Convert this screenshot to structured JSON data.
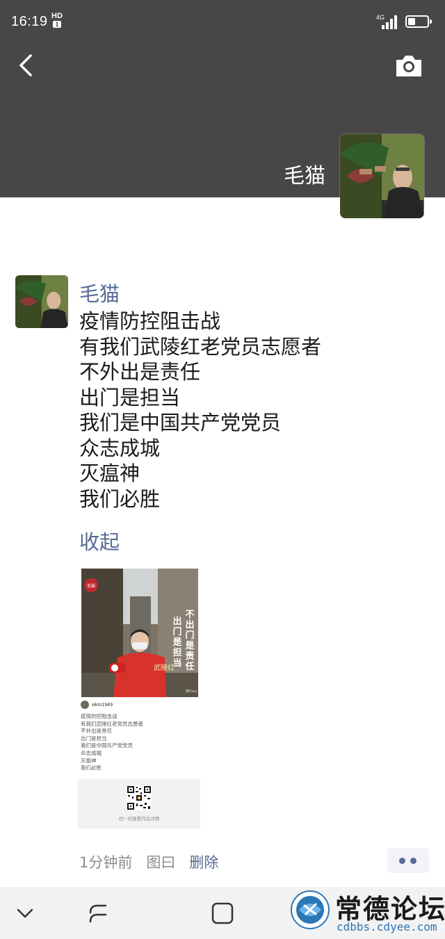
{
  "status_bar": {
    "time": "16:19",
    "hd_label": "HD",
    "hd_sub": "1",
    "network": "4G",
    "signal_icon": "signal-bars-icon",
    "battery_icon": "battery-icon",
    "battery_level": 0.4
  },
  "header": {
    "back_icon": "chevron-left-icon",
    "camera_icon": "camera-icon",
    "profile_name": "毛猫"
  },
  "post": {
    "author": "毛猫",
    "lines": [
      "疫情防控阻击战",
      "有我们武陵红老党员志愿者",
      "不外出是责任",
      "出门是担当",
      "我们是中国共产党党员",
      "众志成城",
      "灭瘟神",
      "我们必胜"
    ],
    "collapse_label": "收起",
    "card": {
      "poster_badge": "毛猫",
      "poster_calligraphy_col1": "不出门是责任",
      "poster_calligraphy_col2": "出门是担当",
      "poster_vest_text": "武陵红",
      "poster_watermark": "微Face",
      "username": "wkm1949",
      "text_lines": [
        "疫情防控阻击战",
        "有我们武陵红老党员志愿者",
        "不外出是责任",
        "出门是担当",
        "我们是中国共产党党员",
        "众志成城",
        "灭瘟神",
        "我们必胜"
      ],
      "qr_caption": "扫一扫查看作品详情"
    },
    "meta": {
      "time": "1分钟前",
      "source": "图曰",
      "delete_label": "删除"
    },
    "more_icon": "more-dots-icon"
  },
  "nav_bar": {
    "hide_icon": "chevron-down-icon",
    "back_icon": "nav-back-icon",
    "home_icon": "nav-home-icon"
  },
  "watermark": {
    "title": "常德论坛",
    "url": "cdbbs.cdyee.com"
  },
  "colors": {
    "link": "#576b95",
    "cover_bg": "#474747",
    "nav_bg": "#f2f2f2"
  }
}
